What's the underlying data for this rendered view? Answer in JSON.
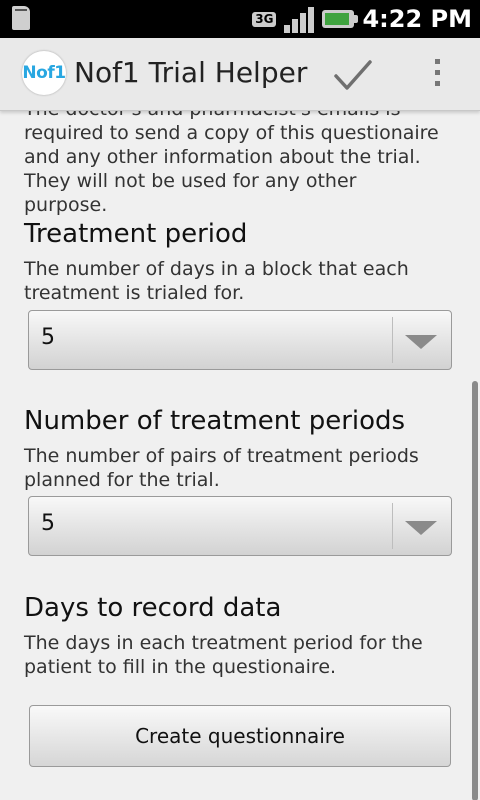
{
  "status_bar": {
    "network_label": "3G",
    "time": "4:22 PM",
    "icons": [
      "sd-card-icon",
      "network-3g-icon",
      "signal-icon",
      "battery-icon"
    ]
  },
  "action_bar": {
    "logo_text": "Nof1",
    "title": "Nof1 Trial Helper",
    "icons": [
      "check-icon",
      "overflow-menu-icon"
    ]
  },
  "intro": {
    "text": "The doctor's and pharmacist's emails is required to send a copy of this questionaire and any other information about the trial. They will not be used for any other purpose."
  },
  "treatment_period": {
    "heading": "Treatment period",
    "description": "The number of days in a block that each treatment is trialed for.",
    "selected_value": "5"
  },
  "number_of_periods": {
    "heading": "Number of treatment periods",
    "description": "The number of pairs of treatment periods planned for the trial.",
    "selected_value": "5"
  },
  "days_to_record": {
    "heading": "Days to record data",
    "description": "The days in each treatment period for the patient to fill in the questionaire."
  },
  "create_button": {
    "label": "Create questionnaire"
  }
}
